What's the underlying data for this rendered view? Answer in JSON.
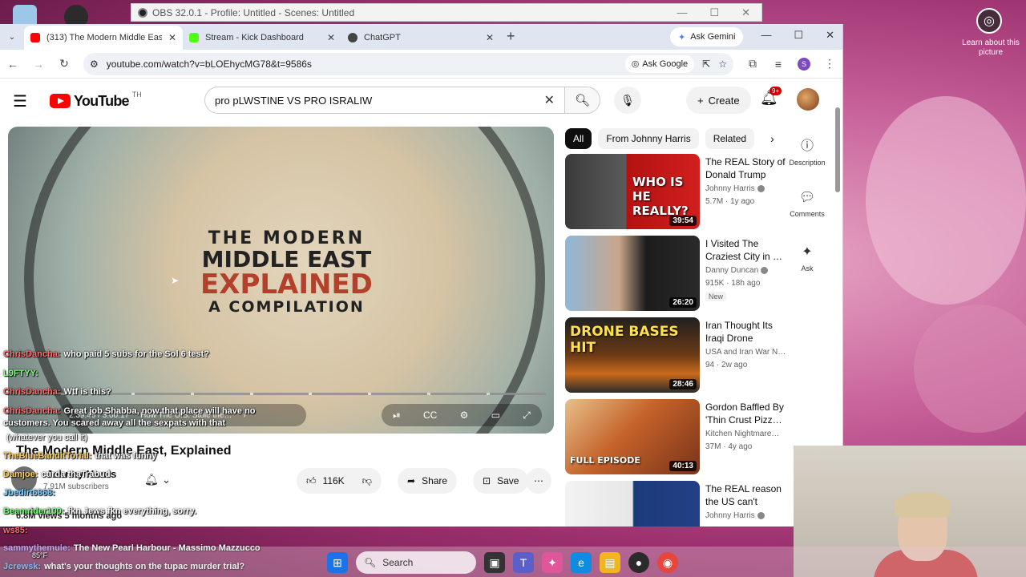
{
  "obs": {
    "title": "OBS 32.0.1 - Profile: Untitled - Scenes: Untitled"
  },
  "gemini_overlay": {
    "label": "Learn about this picture"
  },
  "browser": {
    "tabs": [
      {
        "title": "(313) The Modern Middle East, E",
        "color": "#ff0000"
      },
      {
        "title": "Stream - Kick Dashboard",
        "color": "#53fc18"
      },
      {
        "title": "ChatGPT",
        "color": "#444444"
      }
    ],
    "ask_gemini": "Ask Gemini",
    "url": "youtube.com/watch?v=bLOEhycMG78&t=9586s",
    "ask_google": "Ask Google",
    "profile_letter": "S"
  },
  "youtube": {
    "logo_text": "YouTube",
    "country": "TH",
    "search_query": "pro pLWSTINE VS PRO ISRALIW",
    "create_label": "Create",
    "notif_count": "9+",
    "player": {
      "line1": "THE MODERN",
      "line2": "MIDDLE EAST",
      "line3": "EXPLAINED",
      "line4": "A COMPILATION",
      "time": "2:39:46 / 3:00:17",
      "chapter": "How The U.S. Stole the…"
    },
    "video_title": "The Modern Middle East, Explained",
    "channel": {
      "name": "Johnny Harris",
      "subs": "7.91M subscribers"
    },
    "likes": "116K",
    "share_label": "Share",
    "save_label": "Save",
    "views_line": "6.8M views  5 months ago",
    "chips": [
      "All",
      "From Johnny Harris",
      "Related"
    ],
    "recommendations": [
      {
        "title": "The REAL Story of Donald Trump",
        "channel": "Johnny Harris",
        "meta": "5.7M · 1y ago",
        "duration": "39:54",
        "thumb_text": "WHO IS HE REALLY?",
        "badge": ""
      },
      {
        "title": "I Visited The Craziest City in …",
        "channel": "Danny Duncan",
        "meta": "915K · 18h ago",
        "duration": "26:20",
        "thumb_text": "",
        "badge": "New"
      },
      {
        "title": "Iran Thought Its Iraqi Drone Base…",
        "channel": "USA and Iran War N…",
        "meta": "94 · 2w ago",
        "duration": "28:46",
        "thumb_text": "DRONE BASES HIT",
        "badge": ""
      },
      {
        "title": "Gordon Baffled By 'Thin Crust Pizz…",
        "channel": "Kitchen Nightmare…",
        "meta": "37M · 4y ago",
        "duration": "40:13",
        "thumb_text": "FULL EPISODE",
        "badge": ""
      },
      {
        "title": "The REAL reason the US can't bea…",
        "channel": "Johnny Harris",
        "meta": "",
        "duration": "",
        "thumb_text": "",
        "badge": ""
      }
    ],
    "rail": {
      "description": "Description",
      "comments": "Comments",
      "ask": "Ask"
    }
  },
  "chat": [
    {
      "user": "ChrisDancha:",
      "msg": "who paid 5 subs for the Sol 6 test?",
      "color": "#ff6b6b"
    },
    {
      "user": "L9FTYY:",
      "msg": "",
      "color": "#7dff7d"
    },
    {
      "user": "ChrisDancha:",
      "msg": "Wtf is this?",
      "color": "#ff6b6b"
    },
    {
      "user": "ChrisDancha:",
      "msg": "Great job Shabba, now that place will have no customers. You scared away all the sexpats with that",
      "color": "#ff6b6b"
    },
    {
      "user": "",
      "msg": "(whatever you call it)",
      "color": "#ffffff"
    },
    {
      "user": "TheBlueBanditTorial:",
      "msg": "that was funny",
      "color": "#ffd166"
    },
    {
      "user": "Damjoe:",
      "msg": "curda thaTrabud",
      "color": "#ffd166"
    },
    {
      "user": "Jbedirt6868:",
      "msg": "",
      "color": "#7dd3fc"
    },
    {
      "user": "Beamrider100:",
      "msg": "fkn Jews fkn everything, sorry.",
      "color": "#7dff7d"
    },
    {
      "user": "ws85:",
      "msg": "",
      "color": "#ff6b6b"
    },
    {
      "user": "sammythemule:",
      "msg": "The New Pearl Harbour - Massimo Mazzucco",
      "color": "#c084fc"
    },
    {
      "user": "Jcrewsk:",
      "msg": "what's your thoughts on the tupac murder trial?",
      "color": "#60a5fa"
    }
  ],
  "taskbar": {
    "search": "Search",
    "temp": "85°F"
  }
}
